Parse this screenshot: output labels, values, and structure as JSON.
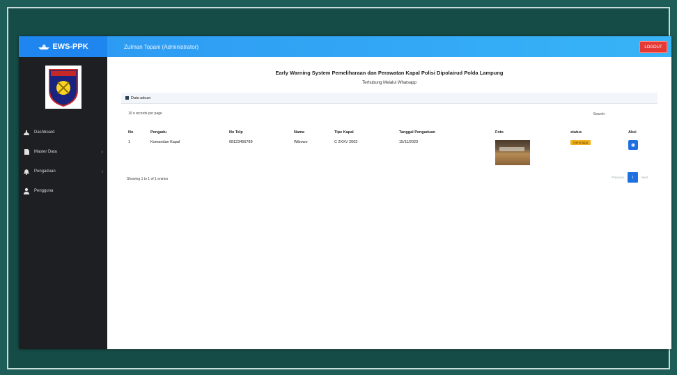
{
  "brand": {
    "name": "EWS-PPK"
  },
  "topbar": {
    "user": "Zulman Topani (Administrator)",
    "logout": "LOGOUT"
  },
  "sidebar": {
    "items": [
      {
        "label": "Dashboard",
        "icon": "dashboard-icon",
        "has_submenu": false
      },
      {
        "label": "Master Data",
        "icon": "file-icon",
        "has_submenu": true
      },
      {
        "label": "Pengaduan",
        "icon": "bell-icon",
        "has_submenu": true
      },
      {
        "label": "Pengguna",
        "icon": "user-icon",
        "has_submenu": false
      }
    ]
  },
  "main": {
    "title": "Early Warning System Pemeliharaan dan Perawatan Kapal Polisi Dipolairud Polda Lampung",
    "subtitle": "Terhubung Melalui Whatsapp",
    "card_title": "Data aduan",
    "length_value": "10",
    "length_label": "records per page",
    "search_label": "Search:",
    "columns": [
      "No",
      "Pengadu",
      "No Telp",
      "Nama",
      "Tipe Kapal",
      "Tanggal Pengaduan",
      "Foto",
      "status",
      "Aksi"
    ],
    "rows": [
      {
        "no": "1",
        "pengadu": "Komandan Kapal",
        "telp": "08123456789",
        "nama": "Wibowo",
        "tipe": "C 2XXV 2003",
        "tanggal": "15/11/2023",
        "status": "menunggu"
      }
    ],
    "info": "Showing 1 to 1 of 1 entries",
    "pager": {
      "prev": "Previous",
      "page": "1",
      "next": "Next"
    }
  },
  "colors": {
    "accent": "#1f86f0",
    "sidebar": "#1d1f22",
    "logout": "#e53935",
    "status_pending": "#f2b01e"
  }
}
